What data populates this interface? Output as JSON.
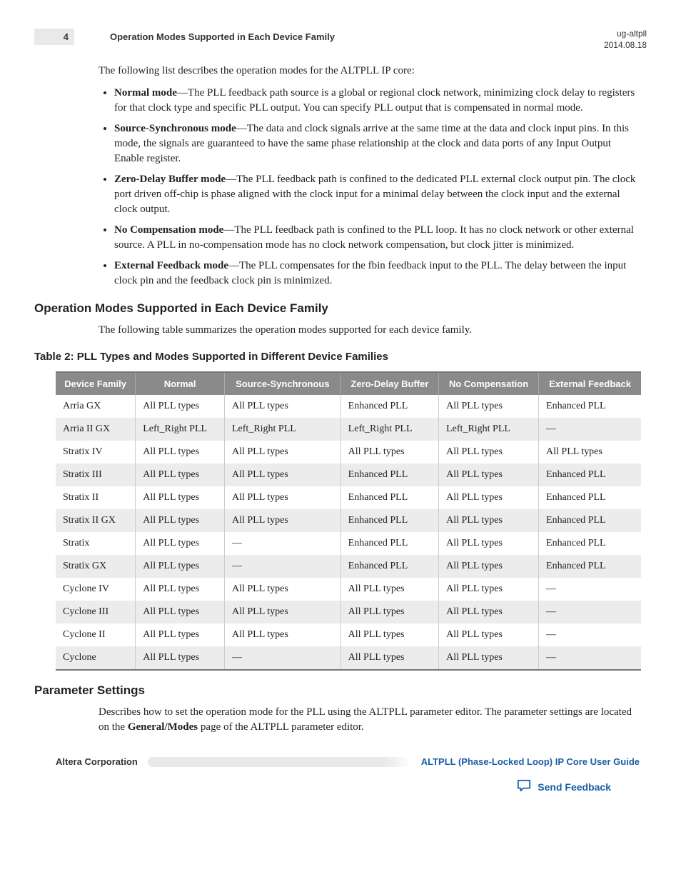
{
  "header": {
    "page_number": "4",
    "running_title": "Operation Modes Supported in Each Device Family",
    "doc_id": "ug-altpll",
    "date": "2014.08.18"
  },
  "intro": "The following list describes the operation modes for the ALTPLL IP core:",
  "modes": [
    {
      "name": "Normal mode",
      "desc": "—The PLL feedback path source is a global or regional clock network, minimizing clock delay to registers for that clock type and specific PLL output. You can specify PLL output that is compensated in normal mode."
    },
    {
      "name": "Source-Synchronous mode",
      "desc": "—The data and clock signals arrive at the same time at the data and clock input pins. In this mode, the signals are guaranteed to have the same phase relationship at the clock and data ports of any Input Output Enable register."
    },
    {
      "name": "Zero-Delay Buffer mode",
      "desc": "—The PLL feedback path is confined to the dedicated PLL external clock output pin. The clock port driven off-chip is phase aligned with the clock input for a minimal delay between the clock input and the external clock output."
    },
    {
      "name": "No Compensation mode",
      "desc": "—The PLL feedback path is confined to the PLL loop. It has no clock network or other external source. A PLL in no-compensation mode has no clock network compensation, but clock jitter is minimized."
    },
    {
      "name": "External Feedback mode",
      "desc": "—The PLL compensates for the fbin feedback input to the PLL. The delay between the input clock pin and the feedback clock pin is minimized."
    }
  ],
  "section1": {
    "title": "Operation Modes Supported in Each Device Family",
    "intro": "The following table summarizes the operation modes supported for each device family."
  },
  "table": {
    "caption": "Table 2: PLL Types and Modes Supported in Different Device Families",
    "headers": [
      "Device Family",
      "Normal",
      "Source-Synchronous",
      "Zero-Delay Buffer",
      "No Compensation",
      "External Feedback"
    ],
    "rows": [
      [
        "Arria GX",
        "All PLL types",
        "All PLL types",
        "Enhanced PLL",
        "All PLL types",
        "Enhanced PLL"
      ],
      [
        "Arria II GX",
        "Left_Right PLL",
        "Left_Right PLL",
        "Left_Right PLL",
        "Left_Right PLL",
        "—"
      ],
      [
        "Stratix IV",
        "All PLL types",
        "All PLL types",
        "All PLL types",
        "All PLL types",
        "All PLL types"
      ],
      [
        "Stratix III",
        "All PLL types",
        "All PLL types",
        "Enhanced PLL",
        "All PLL types",
        "Enhanced PLL"
      ],
      [
        "Stratix II",
        "All PLL types",
        "All PLL types",
        "Enhanced PLL",
        "All PLL types",
        "Enhanced PLL"
      ],
      [
        "Stratix II GX",
        "All PLL types",
        "All PLL types",
        "Enhanced PLL",
        "All PLL types",
        "Enhanced PLL"
      ],
      [
        "Stratix",
        "All PLL types",
        "—",
        "Enhanced PLL",
        "All PLL types",
        "Enhanced PLL"
      ],
      [
        "Stratix GX",
        "All PLL types",
        "—",
        "Enhanced PLL",
        "All PLL types",
        "Enhanced PLL"
      ],
      [
        "Cyclone IV",
        "All PLL types",
        "All PLL types",
        "All PLL types",
        "All PLL types",
        "—"
      ],
      [
        "Cyclone III",
        "All PLL types",
        "All PLL types",
        "All PLL types",
        "All PLL types",
        "—"
      ],
      [
        "Cyclone II",
        "All PLL types",
        "All PLL types",
        "All PLL types",
        "All PLL types",
        "—"
      ],
      [
        "Cyclone",
        "All PLL types",
        "—",
        "All PLL types",
        "All PLL types",
        "—"
      ]
    ]
  },
  "section2": {
    "title": "Parameter Settings",
    "para_pre": "Describes how to set the operation mode for the PLL using the ALTPLL parameter editor. The parameter settings are located on the ",
    "para_bold": "General/Modes",
    "para_post": " page of the ALTPLL parameter editor."
  },
  "footer": {
    "left": "Altera Corporation",
    "right": "ALTPLL (Phase-Locked Loop) IP Core User Guide",
    "feedback": "Send Feedback"
  }
}
